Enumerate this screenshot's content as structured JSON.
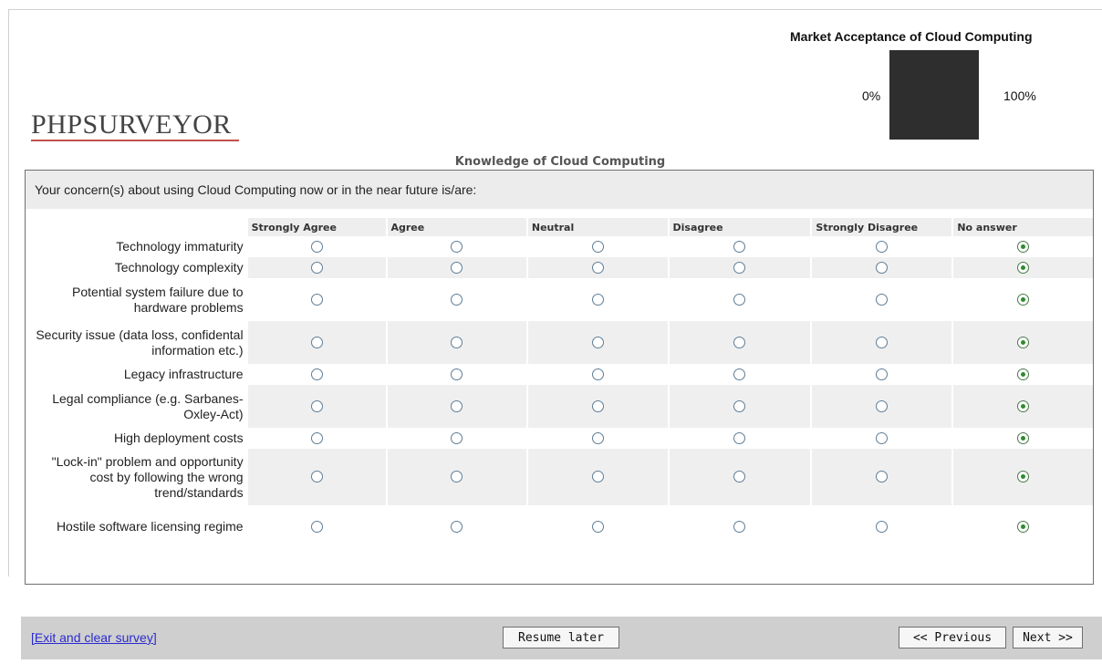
{
  "progress": {
    "title": "Market Acceptance of Cloud Computing",
    "min_label": "0%",
    "max_label": "100%"
  },
  "logo": {
    "text": "PHPSURVEYOR"
  },
  "group_title": "Knowledge of Cloud Computing",
  "question": {
    "text": "Your concern(s) about using Cloud Computing now or in the near future is/are:",
    "columns": [
      "Strongly Agree",
      "Agree",
      "Neutral",
      "Disagree",
      "Strongly Disagree",
      "No answer"
    ],
    "rows": [
      {
        "label": "Technology immaturity",
        "selected": "No answer"
      },
      {
        "label": "Technology complexity",
        "selected": "No answer"
      },
      {
        "label": "Potential system failure due to hardware problems",
        "selected": "No answer"
      },
      {
        "label": "Security issue (data loss, confidental information etc.)",
        "selected": "No answer"
      },
      {
        "label": "Legacy infrastructure",
        "selected": "No answer"
      },
      {
        "label": "Legal compliance (e.g. Sarbanes-Oxley-Act)",
        "selected": "No answer"
      },
      {
        "label": "High deployment costs",
        "selected": "No answer"
      },
      {
        "label": "\"Lock-in\" problem and opportunity cost by following the wrong trend/standards",
        "selected": "No answer"
      },
      {
        "label": "Hostile software licensing regime",
        "selected": "No answer"
      }
    ]
  },
  "navigation": {
    "exit_link": "[Exit and clear survey]",
    "resume_button": "Resume later",
    "previous_button": "<< Previous",
    "next_button": "Next >>"
  }
}
